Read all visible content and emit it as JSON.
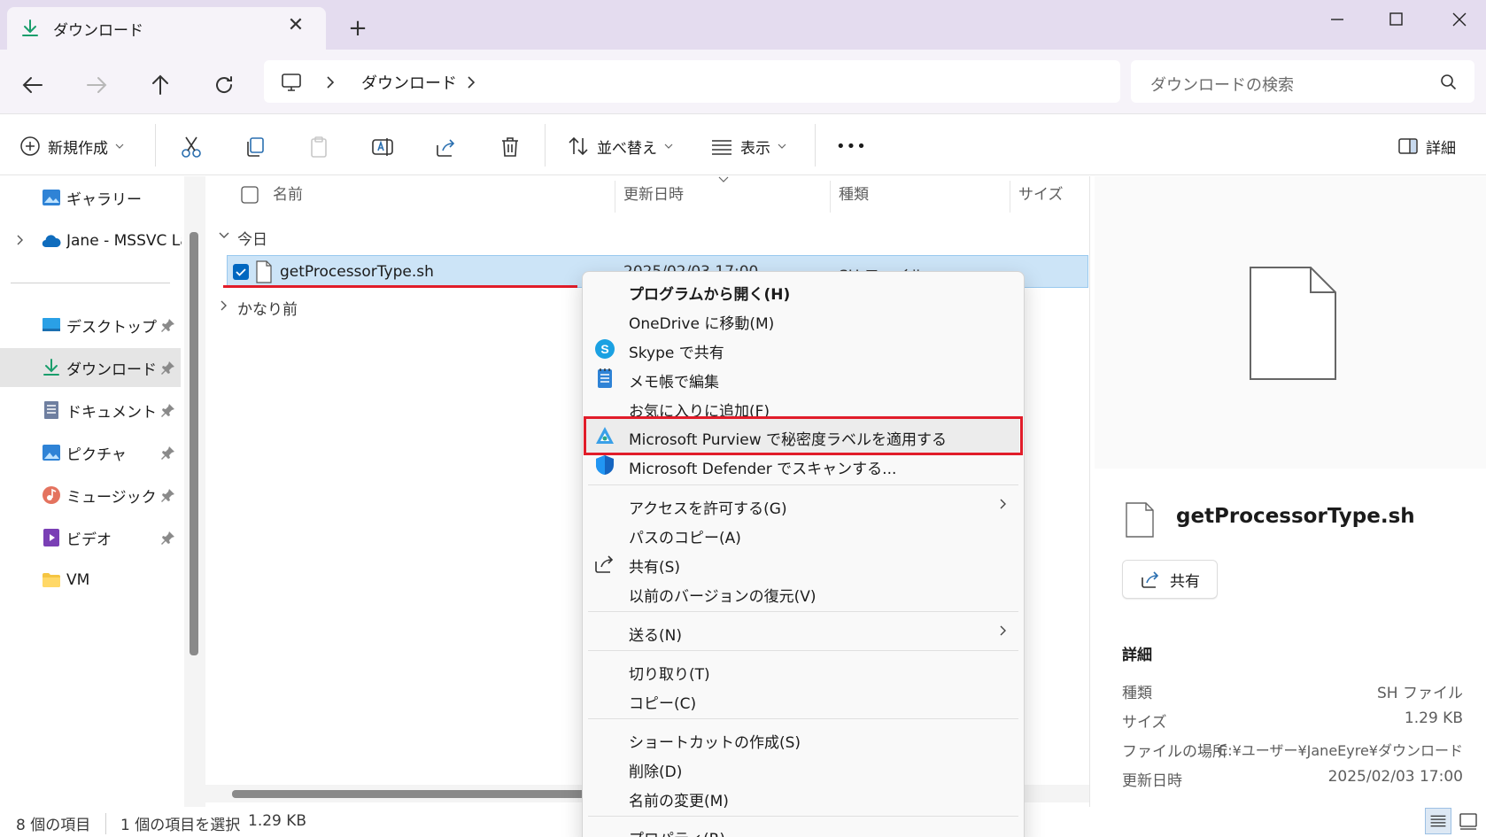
{
  "window": {
    "tab_title": "ダウンロード",
    "new_tab": "+"
  },
  "nav": {
    "breadcrumb": [
      "ダウンロード"
    ],
    "search_placeholder": "ダウンロードの検索"
  },
  "commandbar": {
    "new_label": "新規作成",
    "sort_label": "並べ替え",
    "view_label": "表示",
    "more_label": "•••",
    "details_label": "詳細"
  },
  "sidebar": {
    "items": [
      {
        "label": "ギャラリー",
        "icon": "gallery-icon"
      },
      {
        "label": "Jane - MSSVC Lab",
        "icon": "onedrive-cloud-icon"
      },
      {
        "label": "デスクトップ",
        "icon": "desktop-icon"
      },
      {
        "label": "ダウンロード",
        "icon": "download-icon"
      },
      {
        "label": "ドキュメント",
        "icon": "documents-icon"
      },
      {
        "label": "ピクチャ",
        "icon": "pictures-icon"
      },
      {
        "label": "ミュージック",
        "icon": "music-icon"
      },
      {
        "label": "ビデオ",
        "icon": "video-icon"
      },
      {
        "label": "VM",
        "icon": "folder-icon"
      }
    ]
  },
  "filelist": {
    "columns": [
      "名前",
      "更新日時",
      "種類",
      "サイズ"
    ],
    "groups": [
      "今日",
      "かなり前"
    ],
    "rows": [
      {
        "name": "getProcessorType.sh",
        "modified": "2025/02/03 17:00",
        "type": "SH ファイル",
        "size": ""
      }
    ]
  },
  "context_menu": {
    "items": [
      {
        "label": "プログラムから開く(H)",
        "bold": true
      },
      {
        "label": "OneDrive に移動(M)"
      },
      {
        "label": "Skype で共有"
      },
      {
        "label": "メモ帳で編集"
      },
      {
        "label": "お気に入りに追加(F)"
      },
      {
        "label": "Microsoft Purview で秘密度ラベルを適用する"
      },
      {
        "label": "Microsoft Defender でスキャンする..."
      },
      {
        "label": "アクセスを許可する(G)"
      },
      {
        "label": "パスのコピー(A)"
      },
      {
        "label": "共有(S)"
      },
      {
        "label": "以前のバージョンの復元(V)"
      },
      {
        "label": "送る(N)"
      },
      {
        "label": "切り取り(T)"
      },
      {
        "label": "コピー(C)"
      },
      {
        "label": "ショートカットの作成(S)"
      },
      {
        "label": "削除(D)"
      },
      {
        "label": "名前の変更(M)"
      },
      {
        "label": "プロパティ(R)"
      }
    ]
  },
  "preview": {
    "file_name": "getProcessorType.sh",
    "share_label": "共有",
    "details_title": "詳細",
    "details": [
      {
        "key": "種類",
        "value": "SH ファイル"
      },
      {
        "key": "サイズ",
        "value": "1.29 KB"
      },
      {
        "key": "ファイルの場所",
        "value": "C:¥ユーザー¥JaneEyre¥ダウンロード"
      },
      {
        "key": "更新日時",
        "value": "2025/02/03 17:00"
      }
    ]
  },
  "status": {
    "item_count": "8 個の項目",
    "selection": "1 個の項目を選択",
    "selection_size": "1.29 KB"
  },
  "colors": {
    "accent": "#0067c0",
    "highlight_red": "#e11d2a",
    "selection_bg": "#cce4f7"
  }
}
